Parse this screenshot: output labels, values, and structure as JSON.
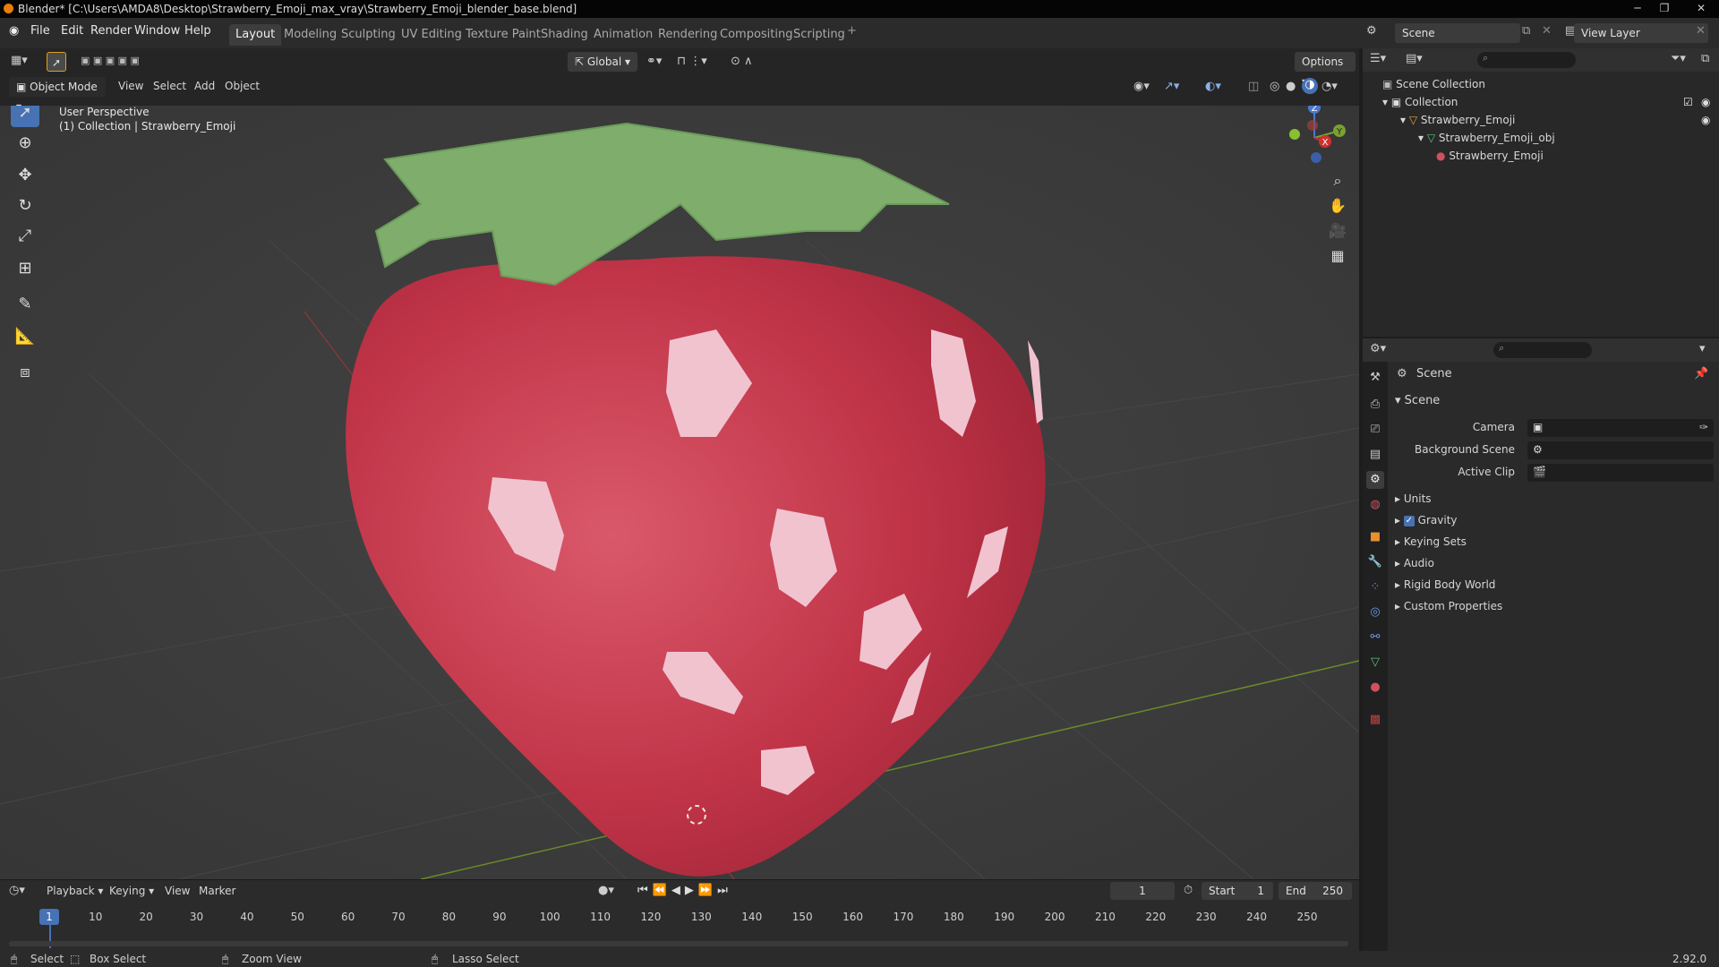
{
  "window_title": "Blender* [C:\\Users\\AMDA8\\Desktop\\Strawberry_Emoji_max_vray\\Strawberry_Emoji_blender_base.blend]",
  "menu": [
    "File",
    "Edit",
    "Render",
    "Window",
    "Help"
  ],
  "workspaces": [
    "Layout",
    "Modeling",
    "Sculpting",
    "UV Editing",
    "Texture Paint",
    "Shading",
    "Animation",
    "Rendering",
    "Compositing",
    "Scripting"
  ],
  "active_workspace": "Layout",
  "scene_name": "Scene",
  "view_layer": "View Layer",
  "viewport": {
    "mode": "Object Mode",
    "menu": [
      "View",
      "Select",
      "Add",
      "Object"
    ],
    "transform_orientation": "Global",
    "options": "Options",
    "overlay_title": "User Perspective",
    "overlay_subtitle": "(1) Collection | Strawberry_Emoji",
    "gizmo_axes": {
      "x": "X",
      "y": "Y",
      "z": "Z"
    }
  },
  "outliner": {
    "rows": [
      "Scene Collection",
      "Collection",
      "Strawberry_Emoji",
      "Strawberry_Emoji_obj",
      "Strawberry_Emoji"
    ]
  },
  "properties": {
    "header": "Scene",
    "section": "Scene",
    "fields": [
      {
        "label": "Camera"
      },
      {
        "label": "Background Scene"
      },
      {
        "label": "Active Clip"
      }
    ],
    "panels": [
      "Units",
      "Gravity",
      "Keying Sets",
      "Audio",
      "Rigid Body World",
      "Custom Properties"
    ],
    "gravity_checked": true
  },
  "timeline": {
    "menu": [
      "Playback",
      "Keying",
      "View",
      "Marker"
    ],
    "current_frame": "1",
    "start_label": "Start",
    "start": "1",
    "end_label": "End",
    "end": "250",
    "ticks": [
      "1",
      "10",
      "20",
      "30",
      "40",
      "50",
      "60",
      "70",
      "80",
      "90",
      "100",
      "110",
      "120",
      "130",
      "140",
      "150",
      "160",
      "170",
      "180",
      "190",
      "200",
      "210",
      "220",
      "230",
      "240",
      "250"
    ]
  },
  "status": {
    "select": "Select",
    "box_select": "Box Select",
    "zoom_view": "Zoom View",
    "lasso_select": "Lasso Select",
    "version": "2.92.0"
  },
  "colors": {
    "accent": "#4772b3",
    "strawberry": "#c43a4d",
    "leaf": "#7fae6c",
    "seed": "#f0c3cf"
  }
}
